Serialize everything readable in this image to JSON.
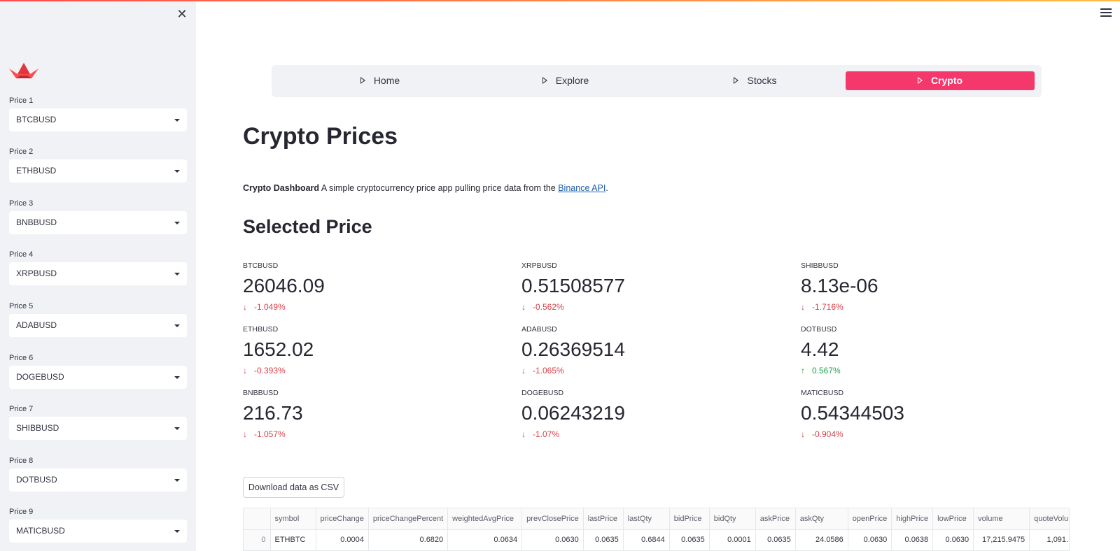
{
  "sidebar": {
    "selects": [
      {
        "label": "Price 1",
        "value": "BTCBUSD"
      },
      {
        "label": "Price 2",
        "value": "ETHBUSD"
      },
      {
        "label": "Price 3",
        "value": "BNBBUSD"
      },
      {
        "label": "Price 4",
        "value": "XRPBUSD"
      },
      {
        "label": "Price 5",
        "value": "ADABUSD"
      },
      {
        "label": "Price 6",
        "value": "DOGEBUSD"
      },
      {
        "label": "Price 7",
        "value": "SHIBBUSD"
      },
      {
        "label": "Price 8",
        "value": "DOTBUSD"
      },
      {
        "label": "Price 9",
        "value": "MATICBUSD"
      }
    ]
  },
  "nav": {
    "items": [
      {
        "label": "Home"
      },
      {
        "label": "Explore"
      },
      {
        "label": "Stocks"
      },
      {
        "label": "Crypto"
      }
    ],
    "active": "Crypto"
  },
  "colors": {
    "accent": "#f5386b",
    "delta_down": "#d6434b",
    "delta_up": "#21a353",
    "sidebar_bg": "#f0f2f6"
  },
  "main": {
    "title": "Crypto Prices",
    "intro_bold": "Crypto Dashboard",
    "intro_text": "A simple cryptocurrency price app pulling price data from the",
    "intro_link": "Binance API",
    "intro_end": ".",
    "section_title": "Selected Price",
    "metrics": [
      {
        "label": "BTCBUSD",
        "value": "26046.09",
        "delta": "-1.049%",
        "dir": "down"
      },
      {
        "label": "XRPBUSD",
        "value": "0.51508577",
        "delta": "-0.562%",
        "dir": "down"
      },
      {
        "label": "SHIBBUSD",
        "value": "8.13e-06",
        "delta": "-1.716%",
        "dir": "down"
      },
      {
        "label": "ETHBUSD",
        "value": "1652.02",
        "delta": "-0.393%",
        "dir": "down"
      },
      {
        "label": "ADABUSD",
        "value": "0.26369514",
        "delta": "-1.065%",
        "dir": "down"
      },
      {
        "label": "DOTBUSD",
        "value": "4.42",
        "delta": "0.567%",
        "dir": "up"
      },
      {
        "label": "BNBBUSD",
        "value": "216.73",
        "delta": "-1.057%",
        "dir": "down"
      },
      {
        "label": "DOGEBUSD",
        "value": "0.06243219",
        "delta": "-1.07%",
        "dir": "down"
      },
      {
        "label": "MATICBUSD",
        "value": "0.54344503",
        "delta": "-0.904%",
        "dir": "down"
      }
    ],
    "download_label": "Download data as CSV",
    "table": {
      "columns": [
        "",
        "symbol",
        "priceChange",
        "priceChangePercent",
        "weightedAvgPrice",
        "prevClosePrice",
        "lastPrice",
        "lastQty",
        "bidPrice",
        "bidQty",
        "askPrice",
        "askQty",
        "openPrice",
        "highPrice",
        "lowPrice",
        "volume",
        "quoteVolu"
      ],
      "rows": [
        [
          "0",
          "ETHBTC",
          "0.0004",
          "0.6820",
          "0.0634",
          "0.0630",
          "0.0635",
          "0.6844",
          "0.0635",
          "0.0001",
          "0.0635",
          "24.0586",
          "0.0630",
          "0.0638",
          "0.0630",
          "17,215.9475",
          "1,091."
        ]
      ]
    }
  }
}
